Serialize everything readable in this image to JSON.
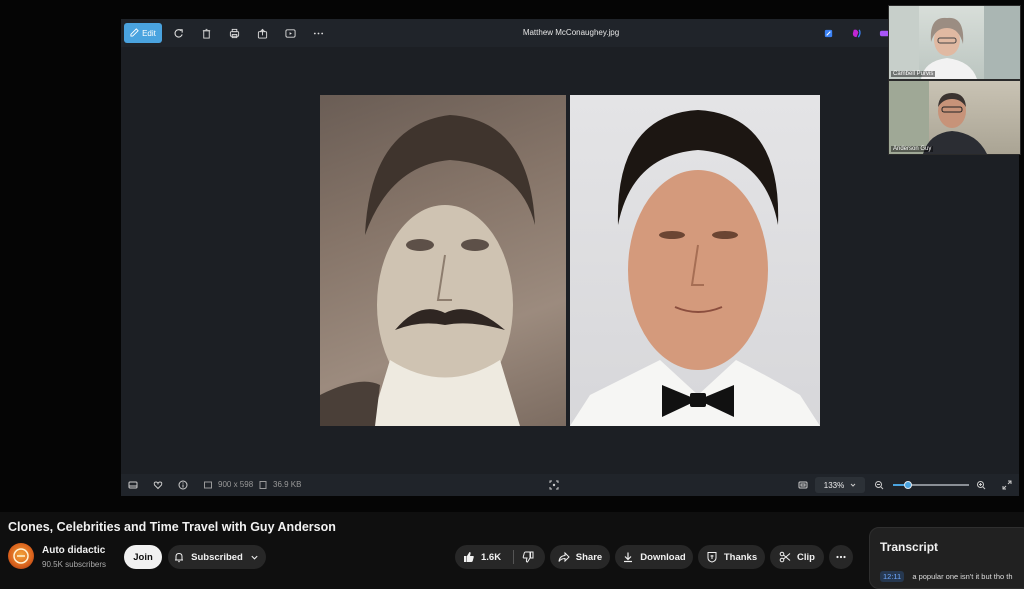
{
  "viewer": {
    "edit_label": "Edit",
    "file_title": "Matthew McConaughey.jpg",
    "dimensions": "900 x 598",
    "file_size": "36.9 KB",
    "zoom": "133%",
    "zoom_fraction": 0.2
  },
  "participants": [
    {
      "name": "Cambell Purvis"
    },
    {
      "name": "Anderson Guy"
    }
  ],
  "video": {
    "title": "Clones, Celebrities and Time Travel with Guy Anderson"
  },
  "channel": {
    "name": "Auto didactic",
    "subscribers": "90.5K subscribers",
    "join_label": "Join",
    "subscribed_label": "Subscribed"
  },
  "actions": {
    "likes": "1.6K",
    "share": "Share",
    "download": "Download",
    "thanks": "Thanks",
    "clip": "Clip"
  },
  "transcript": {
    "title": "Transcript",
    "first_time": "12:11",
    "first_text": "a popular one isn't it but tho th"
  },
  "colors": {
    "accent": "#4aa3df",
    "background": "#0f0f0f",
    "pill": "#272727"
  }
}
